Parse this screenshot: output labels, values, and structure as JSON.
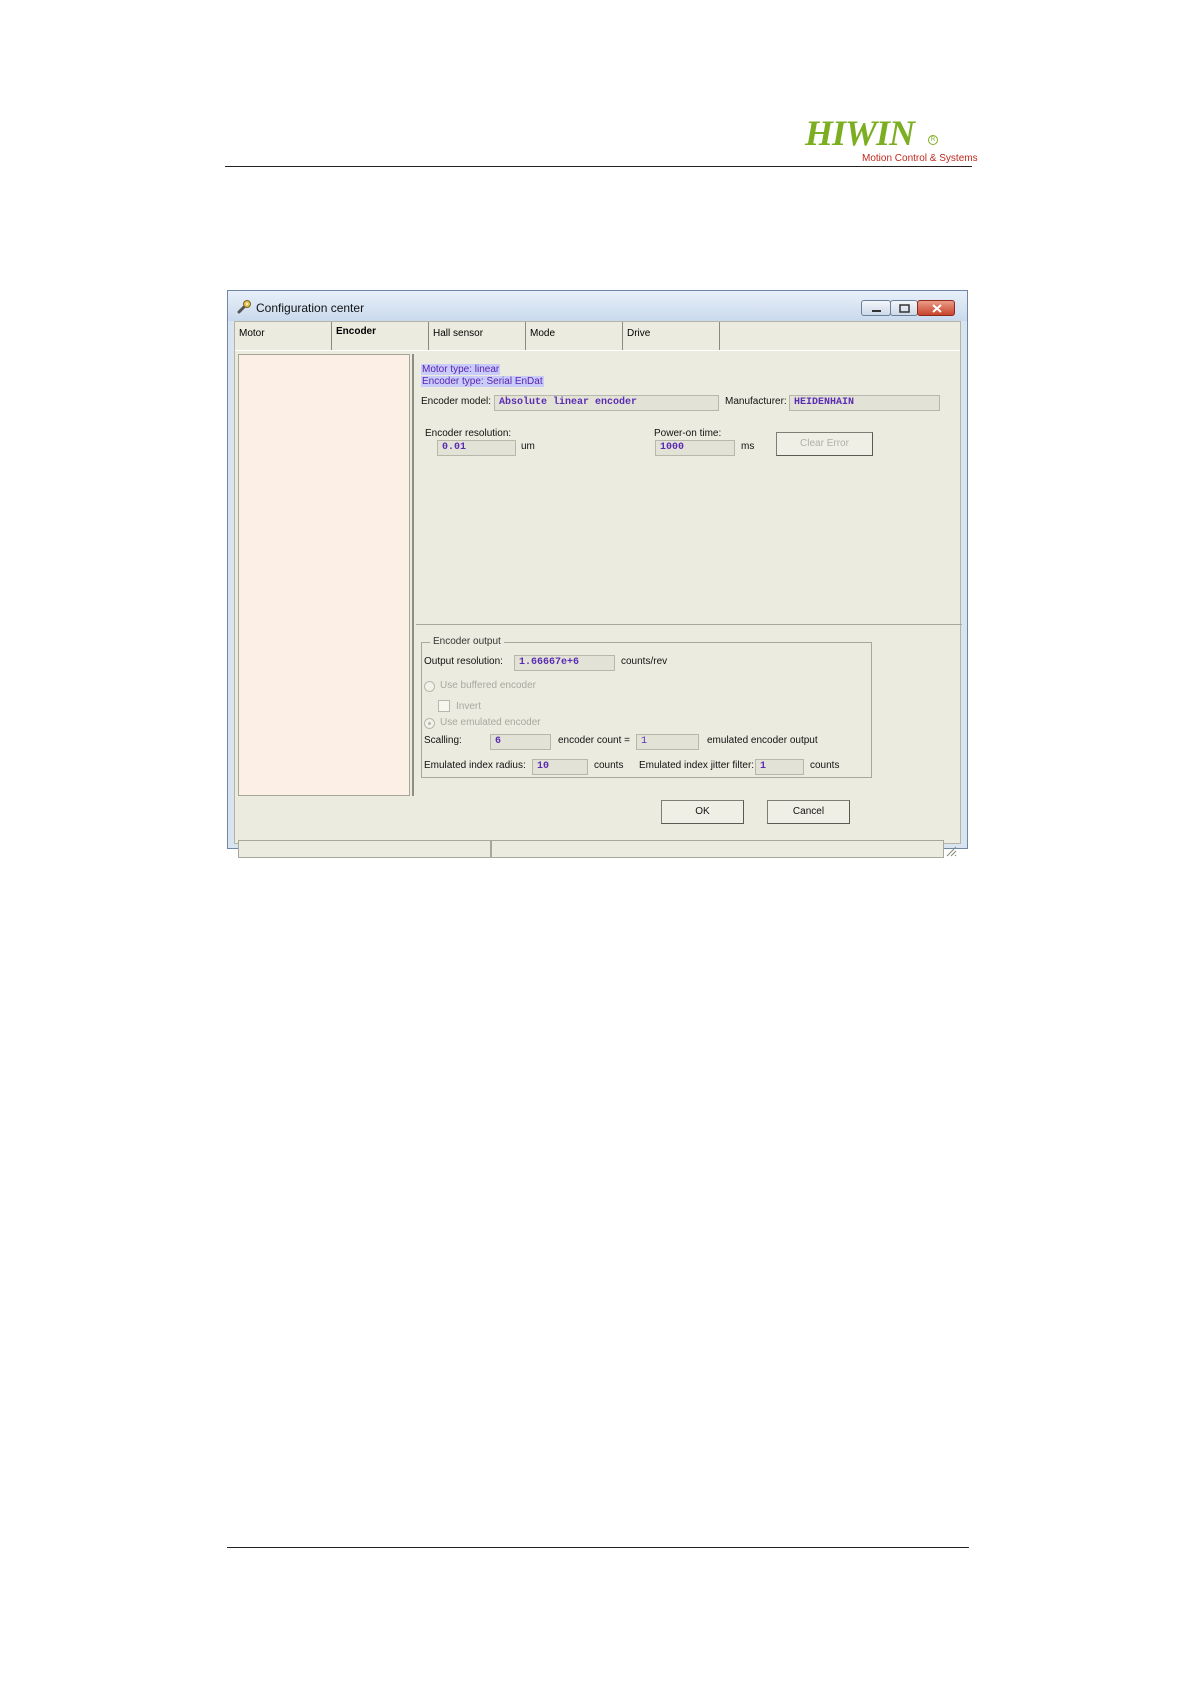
{
  "header": {
    "logo_text": "HIWIN",
    "logo_registered": "R",
    "logo_tagline": "Motion Control & Systems"
  },
  "window": {
    "title": "Configuration center",
    "icon": "wrench-icon",
    "controls": [
      "minimize-icon",
      "maximize-icon",
      "close-icon"
    ]
  },
  "tabs": [
    {
      "label": "Motor",
      "active": false
    },
    {
      "label": "Encoder",
      "active": true
    },
    {
      "label": "Hall sensor",
      "active": false
    },
    {
      "label": "Mode",
      "active": false
    },
    {
      "label": "Drive",
      "active": false
    }
  ],
  "encoder": {
    "motor_type": "Motor type: linear",
    "encoder_type": "Encoder type: Serial EnDat",
    "model_label": "Encoder model:",
    "model_value": "Absolute linear encoder",
    "manufacturer_label": "Manufacturer:",
    "manufacturer_value": "HEIDENHAIN",
    "resolution_label": "Encoder resolution:",
    "resolution_value": "0.01",
    "resolution_unit": "um",
    "power_label": "Power-on time:",
    "power_value": "1000",
    "power_unit": "ms",
    "clear_error_label": "Clear Error"
  },
  "output": {
    "group_title": "Encoder output",
    "resolution_label": "Output resolution:",
    "resolution_value": "1.66667e+6",
    "resolution_unit": "counts/rev",
    "use_buffered_label": "Use buffered encoder",
    "invert_label": "Invert",
    "use_emulated_label": "Use emulated encoder",
    "scalling_label": "Scalling:",
    "scalling_value": "6",
    "encoder_count_label": "encoder count =",
    "emulated_value": "1",
    "emulated_output_label": "emulated encoder output",
    "index_radius_label": "Emulated index radius:",
    "index_radius_value": "10",
    "index_radius_unit": "counts",
    "jitter_label": "Emulated index jitter filter:",
    "jitter_value": "1",
    "jitter_unit": "counts"
  },
  "buttons": {
    "ok": "OK",
    "cancel": "Cancel"
  },
  "colors": {
    "logo_green": "#7cae22",
    "logo_red": "#c0281e",
    "field_text": "#5a2cb4",
    "highlight": "#c9ccf8"
  }
}
